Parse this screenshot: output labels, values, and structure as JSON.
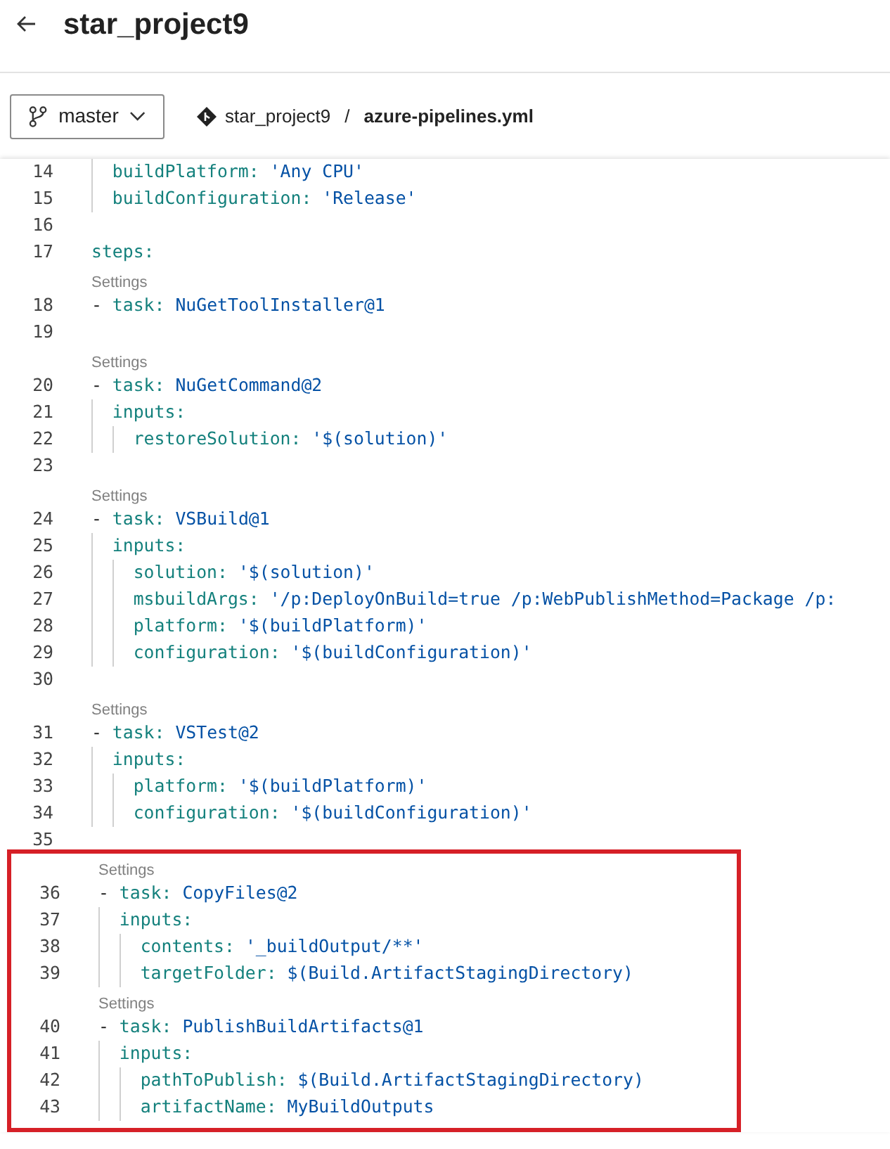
{
  "header": {
    "title": "star_project9"
  },
  "branch": {
    "name": "master"
  },
  "breadcrumb": {
    "repo": "star_project9",
    "separator": "/",
    "file": "azure-pipelines.yml"
  },
  "sections": [
    {
      "highlighted": false,
      "lines": [
        {
          "kind": "code",
          "number": "14",
          "key": "  buildPlatform:",
          "value": "'Any CPU'"
        },
        {
          "kind": "code",
          "number": "15",
          "key": "  buildConfiguration:",
          "value": "'Release'"
        },
        {
          "kind": "blank",
          "number": "16"
        },
        {
          "kind": "code",
          "number": "17",
          "key": "steps:"
        },
        {
          "kind": "settings",
          "label": "Settings"
        },
        {
          "kind": "code",
          "number": "18",
          "prefix": "- ",
          "key": "task:",
          "value": "NuGetToolInstaller@1"
        },
        {
          "kind": "blank",
          "number": "19"
        },
        {
          "kind": "settings",
          "label": "Settings"
        },
        {
          "kind": "code",
          "number": "20",
          "prefix": "- ",
          "key": "task:",
          "value": "NuGetCommand@2"
        },
        {
          "kind": "code",
          "number": "21",
          "key": "  inputs:"
        },
        {
          "kind": "code",
          "number": "22",
          "key": "    restoreSolution:",
          "value": "'$(solution)'"
        },
        {
          "kind": "blank",
          "number": "23"
        },
        {
          "kind": "settings",
          "label": "Settings"
        },
        {
          "kind": "code",
          "number": "24",
          "prefix": "- ",
          "key": "task:",
          "value": "VSBuild@1"
        },
        {
          "kind": "code",
          "number": "25",
          "key": "  inputs:"
        },
        {
          "kind": "code",
          "number": "26",
          "key": "    solution:",
          "value": "'$(solution)'"
        },
        {
          "kind": "code",
          "number": "27",
          "key": "    msbuildArgs:",
          "value": "'/p:DeployOnBuild=true /p:WebPublishMethod=Package /p:"
        },
        {
          "kind": "code",
          "number": "28",
          "key": "    platform:",
          "value": "'$(buildPlatform)'"
        },
        {
          "kind": "code",
          "number": "29",
          "key": "    configuration:",
          "value": "'$(buildConfiguration)'"
        },
        {
          "kind": "blank",
          "number": "30"
        },
        {
          "kind": "settings",
          "label": "Settings"
        },
        {
          "kind": "code",
          "number": "31",
          "prefix": "- ",
          "key": "task:",
          "value": "VSTest@2"
        },
        {
          "kind": "code",
          "number": "32",
          "key": "  inputs:"
        },
        {
          "kind": "code",
          "number": "33",
          "key": "    platform:",
          "value": "'$(buildPlatform)'"
        },
        {
          "kind": "code",
          "number": "34",
          "key": "    configuration:",
          "value": "'$(buildConfiguration)'"
        },
        {
          "kind": "blank",
          "number": "35"
        }
      ]
    },
    {
      "highlighted": true,
      "lines": [
        {
          "kind": "settings",
          "label": "Settings"
        },
        {
          "kind": "code",
          "number": "36",
          "prefix": "- ",
          "key": "task:",
          "value": "CopyFiles@2"
        },
        {
          "kind": "code",
          "number": "37",
          "key": "  inputs:"
        },
        {
          "kind": "code",
          "number": "38",
          "key": "    contents:",
          "value": "'_buildOutput/**'"
        },
        {
          "kind": "code",
          "number": "39",
          "key": "    targetFolder:",
          "value": "$(Build.ArtifactStagingDirectory)"
        },
        {
          "kind": "settings",
          "label": "Settings"
        },
        {
          "kind": "code",
          "number": "40",
          "prefix": "- ",
          "key": "task:",
          "value": "PublishBuildArtifacts@1"
        },
        {
          "kind": "code",
          "number": "41",
          "key": "  inputs:"
        },
        {
          "kind": "code",
          "number": "42",
          "key": "    pathToPublish:",
          "value": "$(Build.ArtifactStagingDirectory)"
        },
        {
          "kind": "code",
          "number": "43",
          "key": "    artifactName:",
          "value": "MyBuildOutputs"
        }
      ]
    }
  ]
}
